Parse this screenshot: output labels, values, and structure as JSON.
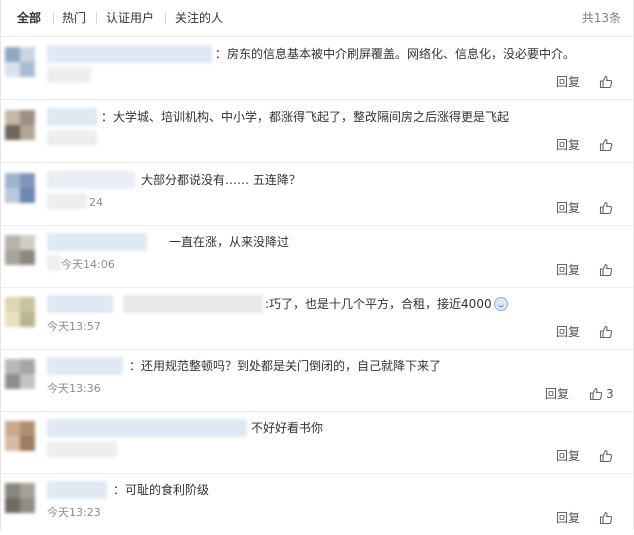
{
  "tabs": [
    "全部",
    "热门",
    "认证用户",
    "关注的人"
  ],
  "total_count": "共13条",
  "reply_label": "回复",
  "comments": [
    {
      "text": "：房东的信息基本被中介刷屏覆盖。网络化、信息化，没必要中介。",
      "time": "",
      "likes": ""
    },
    {
      "text": "：大学城、培训机构、中小学，都涨得飞起了，整改隔间房之后涨得更是飞起",
      "time": "",
      "likes": ""
    },
    {
      "text": "大部分都说没有…… 五连降？",
      "time": "24",
      "likes": ""
    },
    {
      "text": "一直在涨，从来没降过",
      "time": "今天14:06",
      "likes": ""
    },
    {
      "text": ":巧了，也是十几个平方，合租，接近4000",
      "time": "今天13:57",
      "likes": ""
    },
    {
      "text": "：还用规范整顿吗？到处都是关门倒闭的，自己就降下来了",
      "time": "今天13:36",
      "likes": "3"
    },
    {
      "text": "不好好看书你",
      "time": "",
      "likes": ""
    },
    {
      "text": "：可耻的食利阶级",
      "time": "今天13:23",
      "likes": ""
    }
  ],
  "icons": {
    "like": "thumbs-up-icon",
    "emoji": "smiley-emoji-icon"
  }
}
